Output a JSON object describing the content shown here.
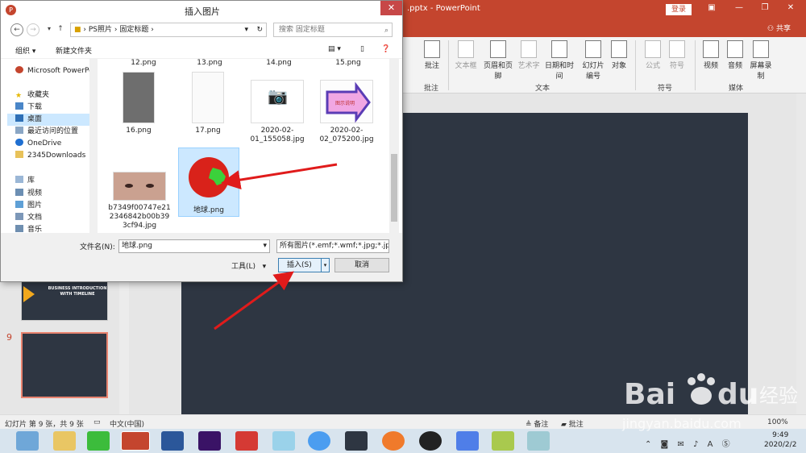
{
  "app": {
    "title_fragment": ".pptx - PowerPoint",
    "login_label": "登录",
    "share_label": "共享"
  },
  "ribbon": {
    "buttons": [
      {
        "label": "批注",
        "icon": "comment-icon"
      },
      {
        "label": "文本框",
        "icon": "textbox-icon",
        "disabled": true
      },
      {
        "label": "页眉和页脚",
        "icon": "header-footer-icon"
      },
      {
        "label": "艺术字",
        "icon": "wordart-icon",
        "disabled": true
      },
      {
        "label": "日期和时间",
        "icon": "datetime-icon"
      },
      {
        "label": "幻灯片编号",
        "icon": "slide-number-icon"
      },
      {
        "label": "对象",
        "icon": "object-icon"
      },
      {
        "label": "公式",
        "icon": "pi-icon",
        "disabled": true
      },
      {
        "label": "符号",
        "icon": "omega-icon",
        "disabled": true
      },
      {
        "label": "视频",
        "icon": "video-icon"
      },
      {
        "label": "音频",
        "icon": "audio-icon"
      },
      {
        "label": "屏幕录制",
        "icon": "screen-record-icon"
      }
    ],
    "groups": [
      "批注",
      "文本",
      "符号",
      "媒体"
    ]
  },
  "thumbnails": {
    "slide8_text": "BUSINESS INTRODUCTION WITH TIMELINE",
    "slide9_number": "9"
  },
  "statusbar": {
    "slide_info": "幻灯片 第 9 张，共 9 张",
    "language": "中文(中国)",
    "notes": "备注",
    "comments": "批注",
    "zoom": "100%"
  },
  "taskbar": {
    "time": "9:49",
    "date": "2020/2/2",
    "ime": "A",
    "apps": [
      "browser-icon",
      "file-explorer-icon",
      "wechat-icon",
      "powerpoint-icon",
      "word-icon",
      "premiere-icon",
      "wps-icon",
      "pet-icon",
      "chrome-icon",
      "video-editor-icon",
      "firefox-icon",
      "qq-icon",
      "feishu-icon",
      "notepad-icon",
      "paper-icon"
    ]
  },
  "dialog": {
    "title": "插入图片",
    "breadcrumb": [
      "PS照片",
      "固定标题"
    ],
    "search_placeholder": "搜索 固定标题",
    "organize": "组织",
    "new_folder": "新建文件夹",
    "nav_items": [
      {
        "label": "Microsoft PowerPoint",
        "icon": "powerpoint-icon"
      },
      {
        "label": "收藏夹",
        "icon": "star-icon"
      },
      {
        "label": "下载",
        "icon": "download-folder-icon"
      },
      {
        "label": "桌面",
        "icon": "desktop-icon",
        "selected": true
      },
      {
        "label": "最近访问的位置",
        "icon": "recent-icon"
      },
      {
        "label": "OneDrive",
        "icon": "cloud-icon"
      },
      {
        "label": "2345Downloads",
        "icon": "folder-icon"
      },
      {
        "label": "库",
        "icon": "library-icon"
      },
      {
        "label": "视频",
        "icon": "video-folder-icon"
      },
      {
        "label": "图片",
        "icon": "pictures-folder-icon"
      },
      {
        "label": "文档",
        "icon": "documents-folder-icon"
      },
      {
        "label": "音乐",
        "icon": "music-folder-icon"
      }
    ],
    "top_row_files": [
      "12.png",
      "13.png",
      "14.png",
      "15.png"
    ],
    "files": [
      {
        "name": "16.png",
        "thumb": "screenshot"
      },
      {
        "name": "17.png",
        "thumb": "document"
      },
      {
        "name": "2020-02-01_155058.jpg",
        "thumb": "camera"
      },
      {
        "name": "2020-02-02_075200.jpg",
        "thumb": "arrow"
      },
      {
        "name": "b7349f00747e212346842b00b393cf94.jpg",
        "thumb": "eyes"
      },
      {
        "name": "地球.png",
        "thumb": "globe",
        "selected": true
      }
    ],
    "arrow_text": "图示说明",
    "filename_label": "文件名(N):",
    "filename_value": "地球.png",
    "filetype_value": "所有图片(*.emf;*.wmf;*.jpg;*.jpeg",
    "tools_label": "工具(L)",
    "insert_label": "插入(S)",
    "cancel_label": "取消"
  },
  "watermark": {
    "brand": "Bai du 经验",
    "url": "jingyan.baidu.com"
  },
  "colors": {
    "ppt_red": "#c4452e",
    "slide_bg": "#2e3642",
    "arrow_red": "#e01b1b"
  }
}
